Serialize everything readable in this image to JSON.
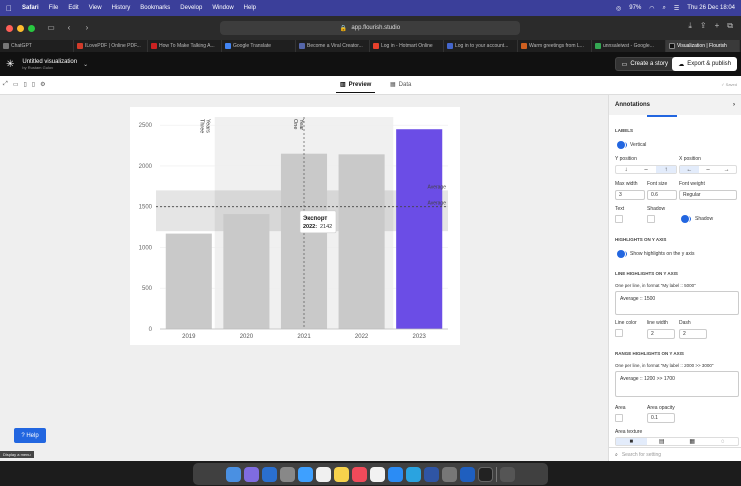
{
  "menubar": {
    "app": "Safari",
    "items": [
      "File",
      "Edit",
      "View",
      "History",
      "Bookmarks",
      "Develop",
      "Window",
      "Help"
    ],
    "battery": "97%",
    "datetime": "Thu 26 Dec 18:04"
  },
  "browser": {
    "url": "app.flourish.studio",
    "tabs": [
      {
        "label": "ChatGPT",
        "color": "#777777"
      },
      {
        "label": "ILovePDF | Online PDF...",
        "color": "#d23b2a"
      },
      {
        "label": "How To Make Talking A...",
        "color": "#cc2222"
      },
      {
        "label": "Google Translate",
        "color": "#4285f4"
      },
      {
        "label": "Become a Viral Creator...",
        "color": "#5566aa"
      },
      {
        "label": "Log in - Hotmart Online",
        "color": "#e8412c"
      },
      {
        "label": "Log in to your account...",
        "color": "#4466cc"
      },
      {
        "label": "Warm greetings from L...",
        "color": "#d06020"
      },
      {
        "label": "unnsaleiwst - Google...",
        "color": "#34a853"
      },
      {
        "label": "Visualization | Flourish",
        "color": "#111111"
      }
    ]
  },
  "header": {
    "title": "Untitled visualization",
    "subtitle": "by Rustam Gulov",
    "create_story": "Create a story",
    "export": "Export & publish"
  },
  "subbar": {
    "preview": "Preview",
    "data": "Data",
    "saved": "✓ Saved"
  },
  "chart_data": {
    "type": "bar",
    "categories": [
      "2019",
      "2020",
      "2021",
      "2022",
      "2023"
    ],
    "values": [
      1170,
      1410,
      2150,
      2142,
      2450
    ],
    "highlight_index": 4,
    "bar_color": "#c9c9c9",
    "highlight_color": "#6b4de6",
    "yticks": [
      0,
      500,
      1000,
      1500,
      2000,
      2500
    ],
    "ylim": [
      0,
      2600
    ],
    "vertical_annotations": [
      {
        "label": "Three Years",
        "at": 0.5,
        "span_to": 4
      },
      {
        "label": "One Year",
        "at": 2.0
      }
    ],
    "line_highlight": {
      "label": "Average",
      "value": 1500
    },
    "range_highlight": {
      "label": "Average",
      "from": 1200,
      "to": 1700
    },
    "tooltip": {
      "title": "Экспорт",
      "label": "2022:",
      "value": "2142"
    }
  },
  "panel": {
    "title": "Annotations",
    "labels_section": "LABELS",
    "vertical": "Vertical",
    "y_position": "Y position",
    "x_position": "X position",
    "max_width": "Max width",
    "max_width_val": "3",
    "font_size": "Font size",
    "font_size_val": "0.6",
    "font_weight": "Font weight",
    "font_weight_val": "Regular",
    "text": "Text",
    "shadow": "Shadow",
    "shadow2": "Shadow",
    "highlights_section": "HIGHLIGHTS ON Y AXIS",
    "show_highlights": "Show highlights on the y axis",
    "line_section": "LINE HIGHLIGHTS ON Y AXIS",
    "line_hint": "One per line, in format \"My label :: 5000\"",
    "line_value": "Average :: 1500",
    "line_color": "Line color",
    "line_width": "line width",
    "line_width_val": "2",
    "dash": "Dash",
    "dash_val": "2",
    "range_section": "RANGE HIGHLIGHTS ON Y AXIS",
    "range_hint": "One per line, in format \"My label :: 2000 >> 3000\"",
    "range_value": "Average :: 1200 >> 1700",
    "area": "Area",
    "area_opacity": "Area opacity",
    "area_opacity_val": "0.1",
    "area_texture": "Area texture",
    "search_placeholder": "Search for setting"
  },
  "help": {
    "button": "? Help",
    "tooltip": "Display a menu"
  }
}
